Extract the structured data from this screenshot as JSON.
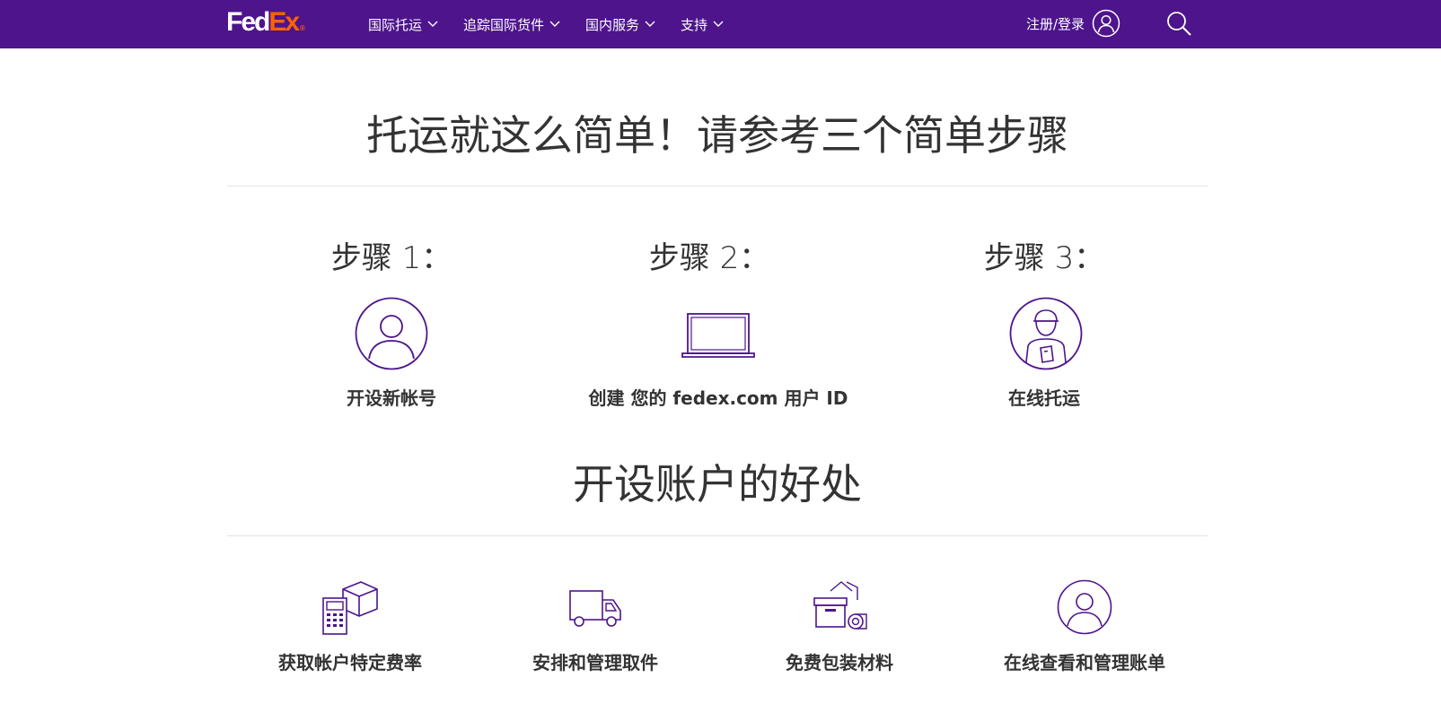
{
  "header": {
    "logo": {
      "fed": "Fed",
      "ex": "Ex",
      "reg": "®"
    },
    "nav": [
      {
        "label": "国际托运"
      },
      {
        "label": "追踪国际货件"
      },
      {
        "label": "国内服务"
      },
      {
        "label": "支持"
      }
    ],
    "login_label": "注册/登录",
    "colors": {
      "brand_purple": "#4d148c",
      "brand_orange": "#ff6200"
    }
  },
  "steps_section": {
    "title": "托运就这么简单！请参考三个简单步骤",
    "steps": [
      {
        "heading": "步骤 1：",
        "label": "开设新帐号",
        "icon": "user-circle-icon"
      },
      {
        "heading": "步骤 2：",
        "label": "创建 您的 fedex.com 用户 ID",
        "icon": "laptop-icon"
      },
      {
        "heading": "步骤 3：",
        "label": "在线托运",
        "icon": "courier-icon"
      }
    ]
  },
  "benefits_section": {
    "title": "开设账户的好处",
    "benefits": [
      {
        "label": "获取帐户特定费率",
        "icon": "calculator-box-icon"
      },
      {
        "label": "安排和管理取件",
        "icon": "truck-icon"
      },
      {
        "label": "免费包装材料",
        "icon": "packaging-icon"
      },
      {
        "label": "在线查看和管理账单",
        "icon": "user-circle-icon"
      }
    ]
  }
}
